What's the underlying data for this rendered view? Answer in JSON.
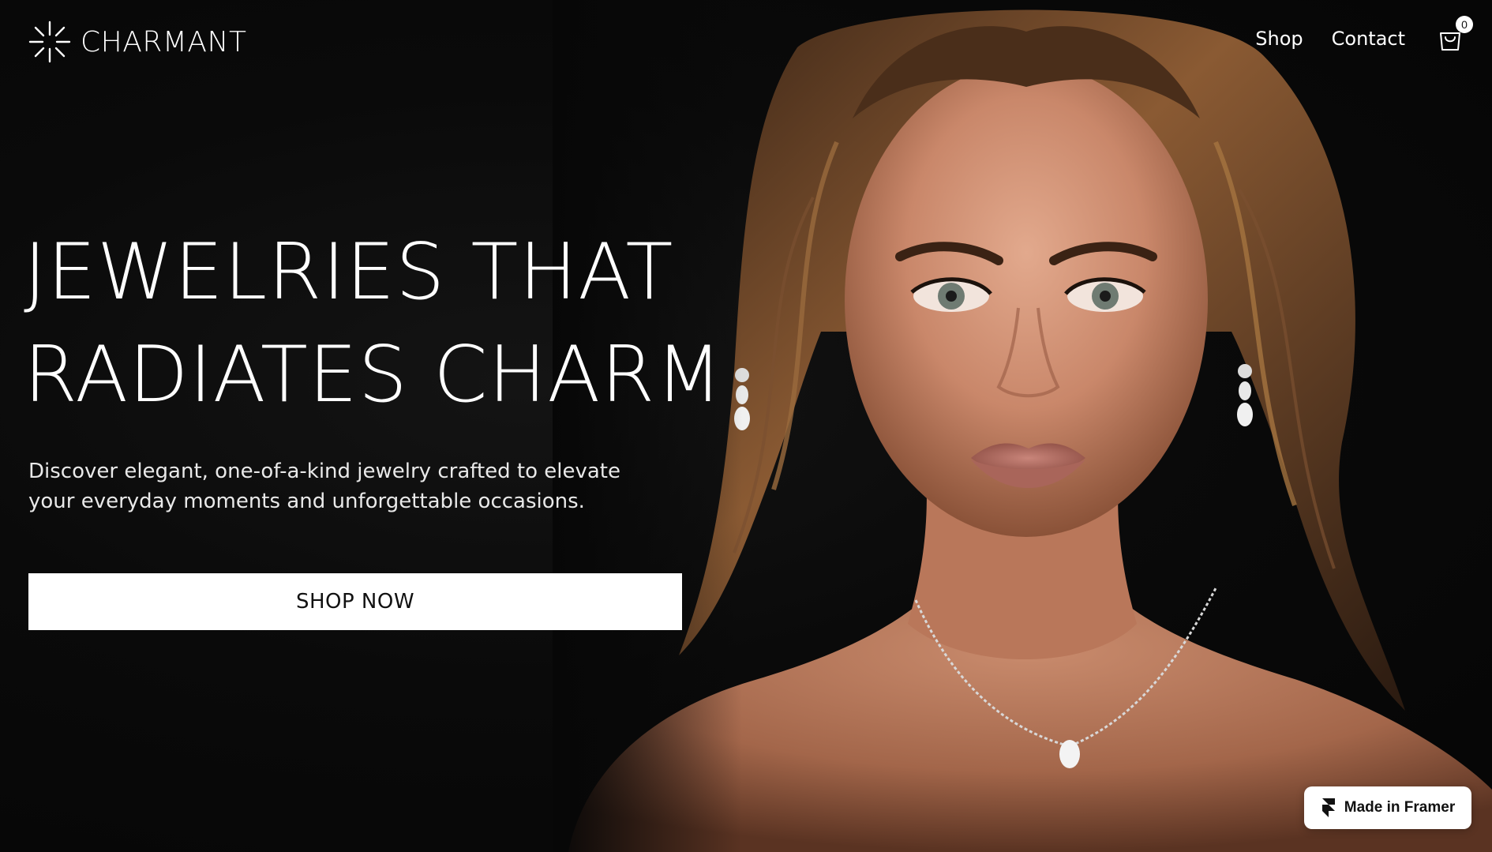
{
  "brand": {
    "name": "CHARMANT",
    "logo_icon": "sparkle-icon"
  },
  "nav": {
    "items": [
      {
        "label": "Shop"
      },
      {
        "label": "Contact"
      }
    ],
    "cart": {
      "icon": "shopping-bag-icon",
      "count": "0"
    }
  },
  "hero": {
    "title_line1": "JEWELRIES THAT",
    "title_line2": "RADIATES CHARM",
    "subtitle": "Discover elegant, one-of-a-kind jewelry crafted to elevate your everyday moments and unforgettable occasions.",
    "cta_label": "SHOP NOW",
    "image": "portrait-of-woman-wearing-earrings-and-necklace"
  },
  "badge": {
    "icon": "framer-icon",
    "label": "Made in Framer"
  },
  "colors": {
    "background": "#070707",
    "text": "#ffffff",
    "button_bg": "#ffffff",
    "button_text": "#111111"
  }
}
